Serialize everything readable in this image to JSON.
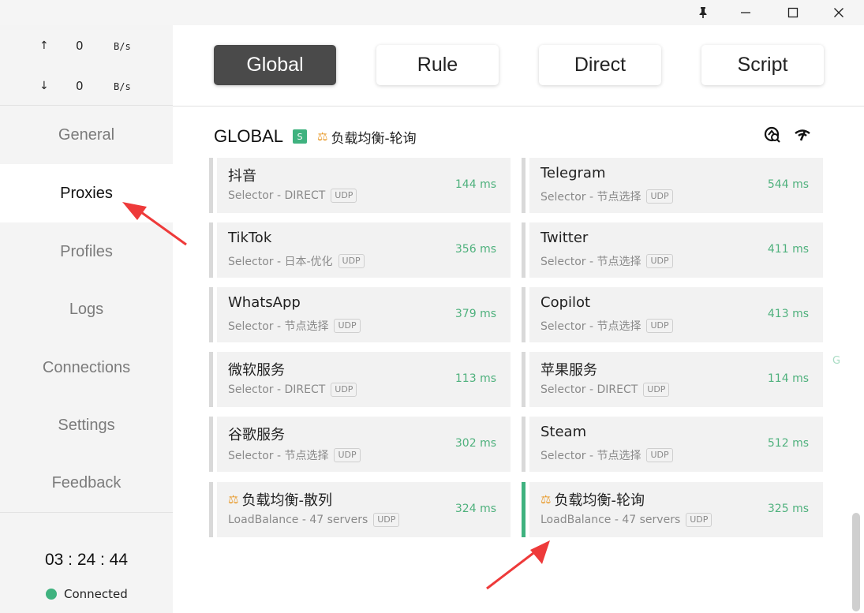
{
  "window": {
    "pin_icon": "pin-icon",
    "minimize": "minimize-icon",
    "maximize": "maximize-icon",
    "close": "close-icon"
  },
  "traffic": {
    "up_arrow": "↑",
    "up_value": "0",
    "up_unit": "B/s",
    "down_arrow": "↓",
    "down_value": "0",
    "down_unit": "B/s"
  },
  "sidebar": {
    "items": [
      {
        "label": "General"
      },
      {
        "label": "Proxies"
      },
      {
        "label": "Profiles"
      },
      {
        "label": "Logs"
      },
      {
        "label": "Connections"
      },
      {
        "label": "Settings"
      },
      {
        "label": "Feedback"
      }
    ],
    "active": "Proxies"
  },
  "status": {
    "timer": "03 : 24 : 44",
    "connection": "Connected",
    "connection_color": "#3fb27f"
  },
  "modes": [
    {
      "label": "Global",
      "active": true
    },
    {
      "label": "Rule",
      "active": false
    },
    {
      "label": "Direct",
      "active": false
    },
    {
      "label": "Script",
      "active": false
    }
  ],
  "group": {
    "title": "GLOBAL",
    "badge": "S",
    "now": "负载均衡-轮询",
    "icons": [
      "latency-test-icon",
      "speed-icon"
    ]
  },
  "proxies": [
    {
      "name": "抖音",
      "sub": "Selector - DIRECT",
      "tag": "UDP",
      "delay": "144 ms"
    },
    {
      "name": "Telegram",
      "sub": "Selector - 节点选择",
      "tag": "UDP",
      "delay": "544 ms"
    },
    {
      "name": "TikTok",
      "sub": "Selector - 日本-优化",
      "tag": "UDP",
      "delay": "356 ms"
    },
    {
      "name": "Twitter",
      "sub": "Selector - 节点选择",
      "tag": "UDP",
      "delay": "411 ms"
    },
    {
      "name": "WhatsApp",
      "sub": "Selector - 节点选择",
      "tag": "UDP",
      "delay": "379 ms"
    },
    {
      "name": "Copilot",
      "sub": "Selector - 节点选择",
      "tag": "UDP",
      "delay": "413 ms"
    },
    {
      "name": "微软服务",
      "sub": "Selector - DIRECT",
      "tag": "UDP",
      "delay": "113 ms"
    },
    {
      "name": "苹果服务",
      "sub": "Selector - DIRECT",
      "tag": "UDP",
      "delay": "114 ms"
    },
    {
      "name": "谷歌服务",
      "sub": "Selector - 节点选择",
      "tag": "UDP",
      "delay": "302 ms"
    },
    {
      "name": "Steam",
      "sub": "Selector - 节点选择",
      "tag": "UDP",
      "delay": "512 ms"
    },
    {
      "name": "负载均衡-散列",
      "sub": "LoadBalance - 47 servers",
      "tag": "UDP",
      "delay": "324 ms",
      "balance": true
    },
    {
      "name": "负载均衡-轮询",
      "sub": "LoadBalance - 47 servers",
      "tag": "UDP",
      "delay": "325 ms",
      "balance": true,
      "selected": true
    }
  ],
  "side_letter": "G",
  "colors": {
    "accent": "#3fb27f",
    "delay": "#4fb17d",
    "annotation_arrow": "#ee3a3a"
  }
}
